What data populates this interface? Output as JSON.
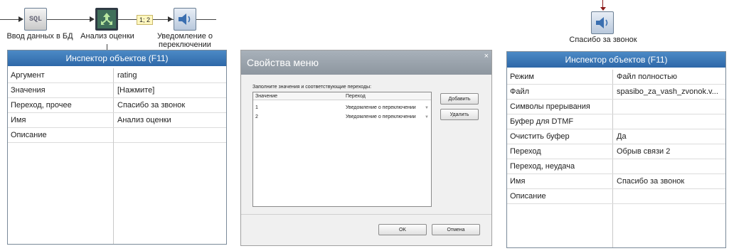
{
  "flow": {
    "nodes": [
      {
        "label": "Ввод данных в БД",
        "icon": "sql-icon",
        "text": "SQL"
      },
      {
        "label": "Анализ оценки",
        "icon": "branch-icon"
      },
      {
        "label": "Уведомление о переключении",
        "icon": "speaker-icon"
      },
      {
        "label": "Спасибо за звонок",
        "icon": "speaker-icon"
      }
    ],
    "edge_label": "1; 2"
  },
  "inspector_left": {
    "title": "Инспектор объектов (F11)",
    "rows": [
      {
        "key": "Аргумент",
        "value": "rating"
      },
      {
        "key": "Значения",
        "value": "[Нажмите]"
      },
      {
        "key": "Переход, прочее",
        "value": "Спасибо за звонок"
      },
      {
        "key": "Имя",
        "value": "Анализ оценки"
      },
      {
        "key": "Описание",
        "value": ""
      }
    ]
  },
  "dialog": {
    "title": "Свойства меню",
    "close": "×",
    "instruction": "Заполните значения и соответствующие переходы:",
    "columns": [
      "Значение",
      "Переход"
    ],
    "rows": [
      {
        "value": "1",
        "transition": "Уведомление о переключении"
      },
      {
        "value": "2",
        "transition": "Уведомление о переключении"
      }
    ],
    "add_label": "Добавить",
    "delete_label": "Удалить",
    "ok_label": "OK",
    "cancel_label": "Отмена"
  },
  "inspector_right": {
    "title": "Инспектор объектов (F11)",
    "rows": [
      {
        "key": "Режим",
        "value": "Файл полностью"
      },
      {
        "key": "Файл",
        "value": "spasibo_za_vash_zvonok.v..."
      },
      {
        "key": "Символы прерывания",
        "value": ""
      },
      {
        "key": "Буфер для DTMF",
        "value": ""
      },
      {
        "key": "Очистить буфер",
        "value": "Да"
      },
      {
        "key": "Переход",
        "value": "Обрыв связи 2"
      },
      {
        "key": "Переход, неудача",
        "value": ""
      },
      {
        "key": "Имя",
        "value": "Спасибо за звонок"
      },
      {
        "key": "Описание",
        "value": ""
      }
    ]
  },
  "colors": {
    "title_bar": "#3a78b8",
    "dialog_title": "#9aa3ac",
    "edge_label_bg": "#fff7c0",
    "arrow_in": "#8b1a1a"
  }
}
